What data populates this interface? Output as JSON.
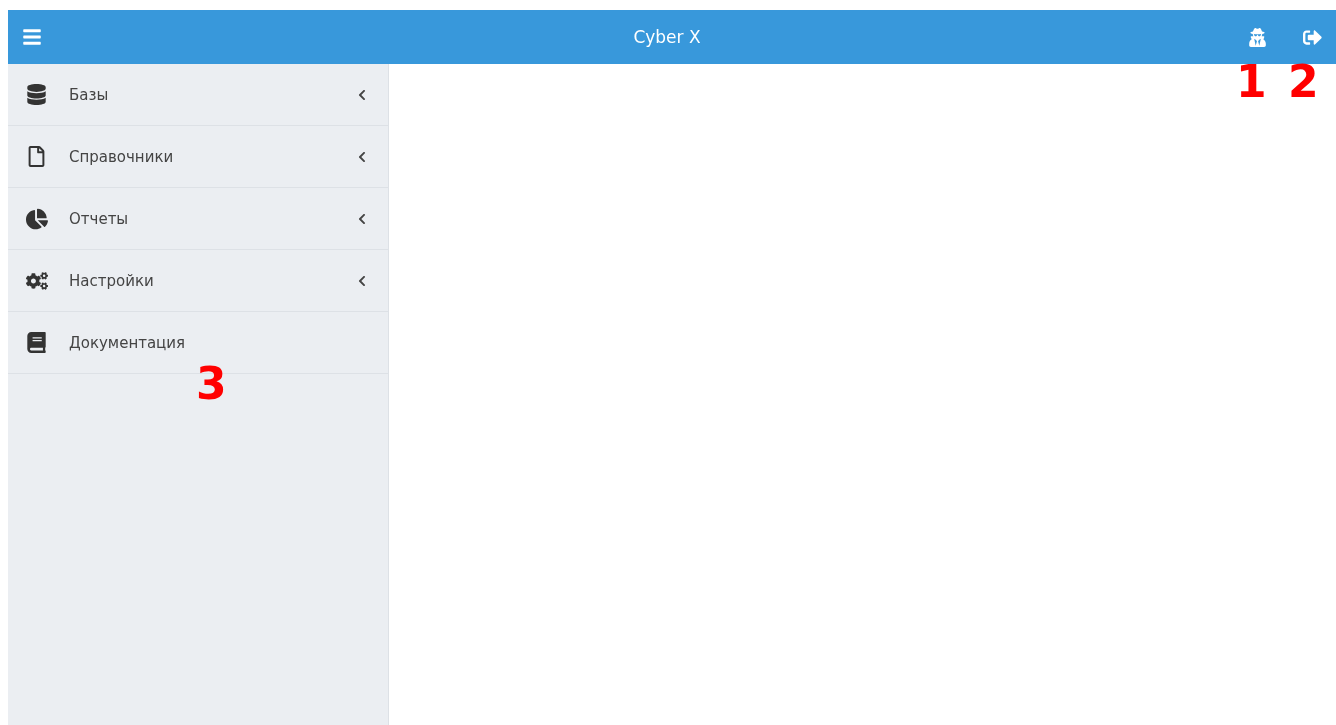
{
  "header": {
    "title": "Cyber X"
  },
  "sidebar": {
    "items": [
      {
        "label": "Базы",
        "kind": "submenu"
      },
      {
        "label": "Справочники",
        "kind": "submenu"
      },
      {
        "label": "Отчеты",
        "kind": "submenu"
      },
      {
        "label": "Настройки",
        "kind": "submenu"
      },
      {
        "label": "Документация",
        "kind": "link"
      }
    ]
  },
  "annotations": [
    {
      "label": "1"
    },
    {
      "label": "2"
    },
    {
      "label": "3"
    }
  ]
}
